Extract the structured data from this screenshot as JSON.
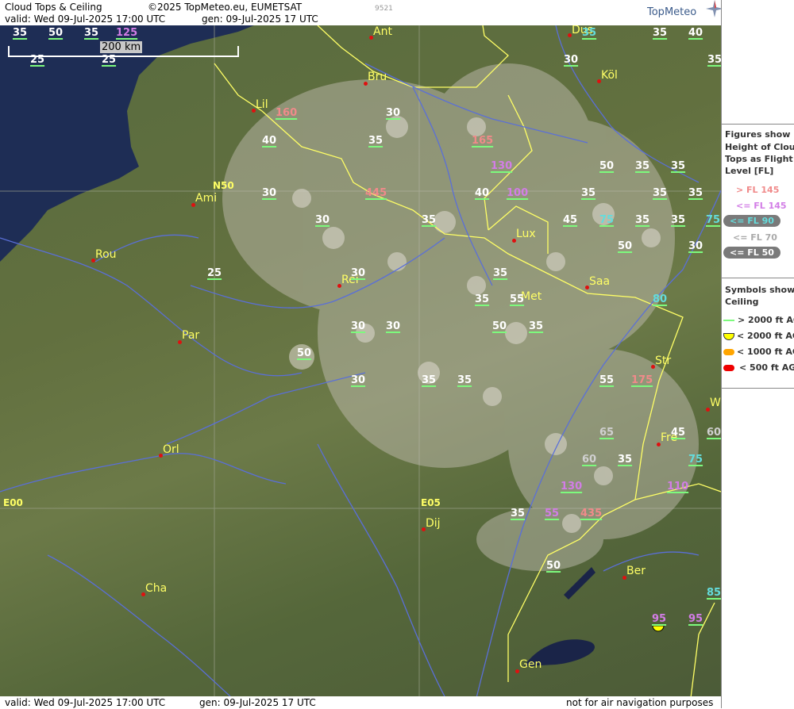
{
  "header": {
    "title": "Cloud Tops & Ceiling",
    "copyright": "©2025 TopMeteo.eu, EUMETSAT",
    "code": "9521",
    "valid": "valid:  Wed  09-Jul-2025  17:00 UTC",
    "gen": "gen: 09-Jul-2025 17 UTC",
    "brand": "TopMeteo"
  },
  "footer": {
    "valid": "valid:  Wed  09-Jul-2025  17:00 UTC",
    "gen": "gen: 09-Jul-2025 17 UTC",
    "disclaimer": "not for air navigation purposes"
  },
  "scale": {
    "label": "200 km"
  },
  "grid_labels": [
    "N50",
    "E00",
    "E05"
  ],
  "cities": [
    "Ant",
    "Dus",
    "Bru",
    "Köl",
    "Lil",
    "Ami",
    "Lux",
    "Rou",
    "Rei",
    "Met",
    "Saa",
    "Par",
    "Str",
    "Orl",
    "Fre",
    "Dij",
    "Ber",
    "Cha",
    "Gen",
    "W"
  ],
  "cloud_tops": [
    {
      "v": "35",
      "c": "white"
    },
    {
      "v": "50",
      "c": "white"
    },
    {
      "v": "35",
      "c": "white"
    },
    {
      "v": "125",
      "c": "violet"
    },
    {
      "v": "25",
      "c": "white"
    },
    {
      "v": "25",
      "c": "white"
    },
    {
      "v": "35",
      "c": "cyan"
    },
    {
      "v": "35",
      "c": "white"
    },
    {
      "v": "40",
      "c": "white"
    },
    {
      "v": "30",
      "c": "white"
    },
    {
      "v": "35",
      "c": "white"
    },
    {
      "v": "160",
      "c": "pink"
    },
    {
      "v": "30",
      "c": "white"
    },
    {
      "v": "40",
      "c": "white"
    },
    {
      "v": "35",
      "c": "white"
    },
    {
      "v": "165",
      "c": "pink"
    },
    {
      "v": "130",
      "c": "violet"
    },
    {
      "v": "50",
      "c": "white"
    },
    {
      "v": "35",
      "c": "white"
    },
    {
      "v": "35",
      "c": "white"
    },
    {
      "v": "30",
      "c": "white"
    },
    {
      "v": "445",
      "c": "pink"
    },
    {
      "v": "40",
      "c": "white"
    },
    {
      "v": "100",
      "c": "violet"
    },
    {
      "v": "35",
      "c": "white"
    },
    {
      "v": "35",
      "c": "white"
    },
    {
      "v": "35",
      "c": "white"
    },
    {
      "v": "30",
      "c": "white"
    },
    {
      "v": "35",
      "c": "white"
    },
    {
      "v": "45",
      "c": "white"
    },
    {
      "v": "75",
      "c": "cyan"
    },
    {
      "v": "35",
      "c": "white"
    },
    {
      "v": "35",
      "c": "white"
    },
    {
      "v": "75",
      "c": "cyan"
    },
    {
      "v": "50",
      "c": "white"
    },
    {
      "v": "30",
      "c": "white"
    },
    {
      "v": "25",
      "c": "white"
    },
    {
      "v": "30",
      "c": "white"
    },
    {
      "v": "35",
      "c": "white"
    },
    {
      "v": "35",
      "c": "white"
    },
    {
      "v": "55",
      "c": "white"
    },
    {
      "v": "80",
      "c": "cyan"
    },
    {
      "v": "30",
      "c": "white"
    },
    {
      "v": "30",
      "c": "white"
    },
    {
      "v": "50",
      "c": "white"
    },
    {
      "v": "35",
      "c": "white"
    },
    {
      "v": "50",
      "c": "white"
    },
    {
      "v": "30",
      "c": "white"
    },
    {
      "v": "35",
      "c": "white"
    },
    {
      "v": "35",
      "c": "white"
    },
    {
      "v": "55",
      "c": "white"
    },
    {
      "v": "175",
      "c": "pink"
    },
    {
      "v": "65",
      "c": "grey"
    },
    {
      "v": "45",
      "c": "white"
    },
    {
      "v": "60",
      "c": "grey"
    },
    {
      "v": "60",
      "c": "grey"
    },
    {
      "v": "35",
      "c": "white"
    },
    {
      "v": "75",
      "c": "cyan"
    },
    {
      "v": "130",
      "c": "violet"
    },
    {
      "v": "110",
      "c": "violet"
    },
    {
      "v": "35",
      "c": "white"
    },
    {
      "v": "55",
      "c": "violet"
    },
    {
      "v": "435",
      "c": "pink"
    },
    {
      "v": "50",
      "c": "white"
    },
    {
      "v": "85",
      "c": "cyan"
    },
    {
      "v": "95",
      "c": "violet"
    },
    {
      "v": "95",
      "c": "violet"
    }
  ],
  "legend": {
    "heading": [
      "Figures show",
      "Height of Cloud",
      "Tops as Flight",
      "Level  [FL]"
    ],
    "levels": [
      "> FL 145",
      "<= FL 145",
      "<= FL 90",
      "<= FL 70",
      "<= FL 50"
    ],
    "ceiling_heading": [
      "Symbols show",
      "Ceiling"
    ],
    "ceiling": [
      "> 2000 ft AGL",
      "< 2000 ft AGL",
      "< 1000 ft AGL",
      "< 500 ft AGL"
    ]
  },
  "colors": {
    "above145": "#f08a8a",
    "le145": "#d27de6",
    "le90": "#64dcdc",
    "le70": "#d0d0d0",
    "le50": "#ffffff",
    "ceil_gt2000": "#7dfa7d",
    "ceil_lt2000": "#ffff00",
    "ceil_lt1000": "#ffa500",
    "ceil_lt500": "#ee0000",
    "sea": "#1e2d55",
    "rivers": "#5a6fd8",
    "borders": "#ffff66"
  }
}
